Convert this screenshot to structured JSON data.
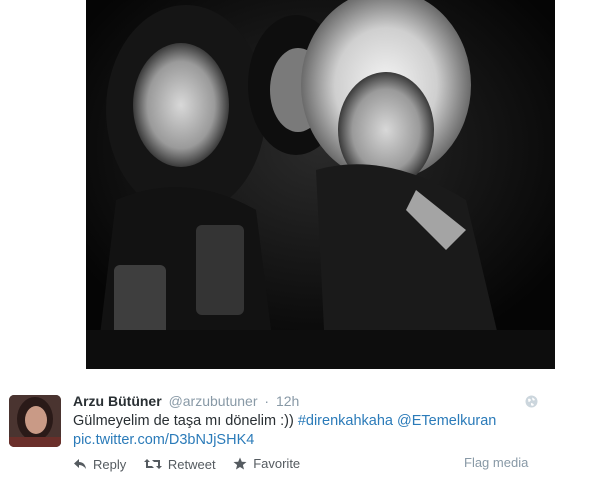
{
  "tweet": {
    "fullname": "Arzu Bütüner",
    "username": "@arzubutuner",
    "separator": "·",
    "time": "12h",
    "text": "Gülmeyelim de taşa mı dönelim :))",
    "hashtag": "#direnkahkaha",
    "mention": "@ETemelkuran",
    "pic_link": "pic.twitter.com/D3bNJjSHK4",
    "colors": {
      "link": "#2b7bb9",
      "text": "#292f33",
      "muted": "#8899a6"
    }
  },
  "actions": {
    "reply": "Reply",
    "retweet": "Retweet",
    "favorite": "Favorite",
    "flag": "Flag media"
  },
  "icons": {
    "globe": "globe-icon",
    "reply": "reply-arrow-icon",
    "retweet": "retweet-icon",
    "favorite": "star-icon"
  }
}
